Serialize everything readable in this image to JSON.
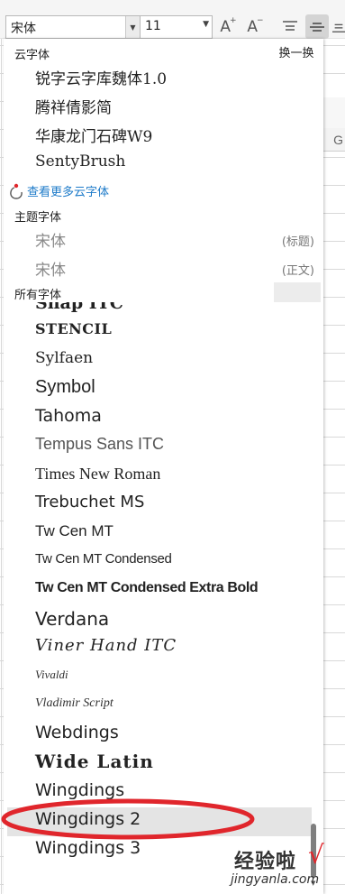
{
  "toolbar": {
    "font_value": "宋体",
    "size_value": "11",
    "grow_font_icon": "A",
    "shrink_font_icon": "A",
    "align_icons": [
      "align-top-icon",
      "align-middle-icon",
      "align-bottom-icon"
    ]
  },
  "column_header": "G",
  "dropdown": {
    "cloud_header": "云字体",
    "swap_button": "换一换",
    "cloud_fonts": [
      "锐字云字库魏体1.0",
      "腾祥倩影简",
      "华康龙门石碑W9",
      "SentyBrush"
    ],
    "more_link": "查看更多云字体",
    "theme_header": "主题字体",
    "theme_fonts": [
      {
        "name": "宋体",
        "tag": "(标题)"
      },
      {
        "name": "宋体",
        "tag": "(正文)"
      }
    ],
    "all_header": "所有字体",
    "all_fonts": [
      "Snap ITC",
      "STENCIL",
      "Sylfaen",
      "Symbol",
      "Tahoma",
      "Tempus Sans ITC",
      "Times New Roman",
      "Trebuchet MS",
      "Tw Cen MT",
      "Tw Cen MT Condensed",
      "Tw Cen MT Condensed Extra Bold",
      "Verdana",
      "Viner Hand ITC",
      "Vivaldi",
      "Vladimir Script",
      "Webdings",
      "Wide Latin",
      "Wingdings",
      "Wingdings 2",
      "Wingdings 3"
    ],
    "hovered_font": "Wingdings 2"
  },
  "watermark": {
    "title": "经验啦",
    "url": "jingyanla.com",
    "check": "√"
  },
  "colors": {
    "link": "#1e7bc9",
    "annotation_red": "#e0262c",
    "hover_bg": "#e4e4e4"
  }
}
